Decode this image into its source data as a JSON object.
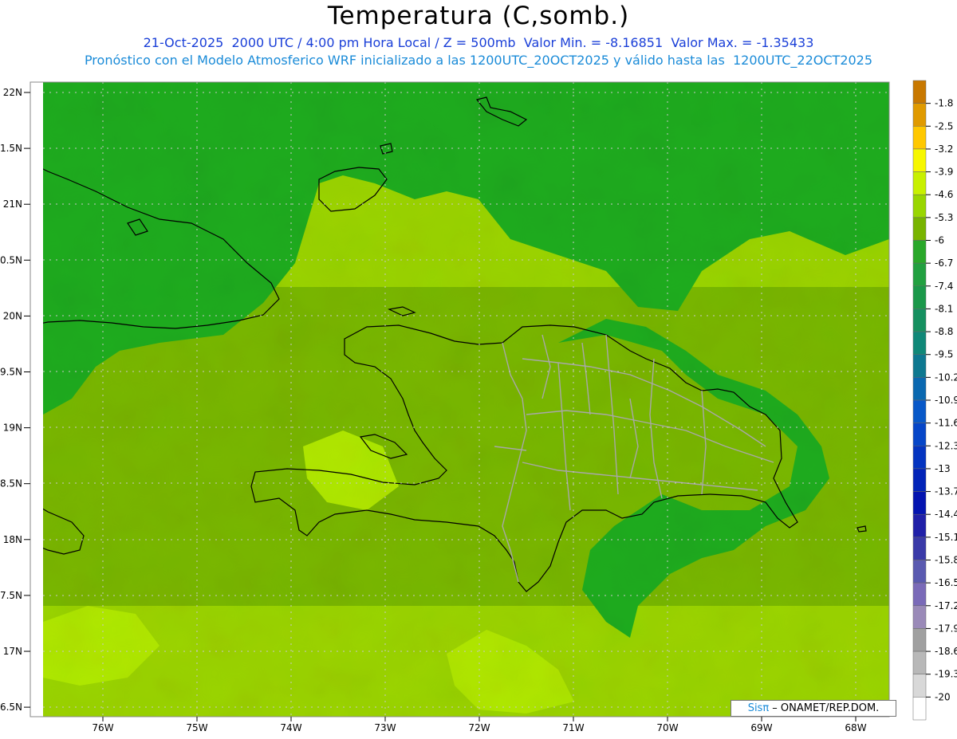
{
  "header": {
    "title": "Temperatura (C,somb.)",
    "line1": "21-Oct-2025  2000 UTC / 4:00 pm Hora Local / Z = 500mb  Valor Min. = -8.16851  Valor Max. = -1.35433",
    "line2": "Pronóstico con el Modelo Atmosferico WRF inicializado a las 1200UTC_20OCT2025 y válido hasta las  1200UTC_22OCT2025"
  },
  "axes": {
    "lat_labels": [
      "22N",
      "1.5N",
      "21N",
      "0.5N",
      "20N",
      "9.5N",
      "19N",
      "8.5N",
      "18N",
      "7.5N",
      "17N",
      "6.5N"
    ],
    "lon_labels": [
      "76W",
      "75W",
      "74W",
      "73W",
      "72W",
      "71W",
      "70W",
      "69W",
      "68W"
    ]
  },
  "colorbar": {
    "labels": [
      "-1.8",
      "-2.5",
      "-3.2",
      "-3.9",
      "-4.6",
      "-5.3",
      "-6",
      "-6.7",
      "-7.4",
      "-8.1",
      "-8.8",
      "-9.5",
      "-10.2",
      "-10.9",
      "-11.6",
      "-12.3",
      "-13",
      "-13.7",
      "-14.4",
      "-15.1",
      "-15.8",
      "-16.5",
      "-17.2",
      "-17.9",
      "-18.6",
      "-19.3",
      "-20"
    ],
    "colors": [
      "#c87800",
      "#e09a00",
      "#ffc800",
      "#f7f700",
      "#c8f000",
      "#99d600",
      "#78b400",
      "#2aa82a",
      "#22a040",
      "#1b984a",
      "#169060",
      "#108878",
      "#0e7890",
      "#0a68b0",
      "#0858c8",
      "#0646c8",
      "#0434c0",
      "#0224b8",
      "#0414b0",
      "#2020a8",
      "#3a3aa8",
      "#5a5ab0",
      "#7a6ab8",
      "#9a8ab8",
      "#a0a0a0",
      "#b8b8b8",
      "#d8d8d8",
      "#ffffff"
    ]
  },
  "field_colors": {
    "base_north": "#1eac1e",
    "mid": "#79b700",
    "south": "#9bd400",
    "bright": "#b0e800"
  },
  "credit": {
    "brand": "Sisπ",
    "text": " – ONAMET/REP.DOM."
  }
}
